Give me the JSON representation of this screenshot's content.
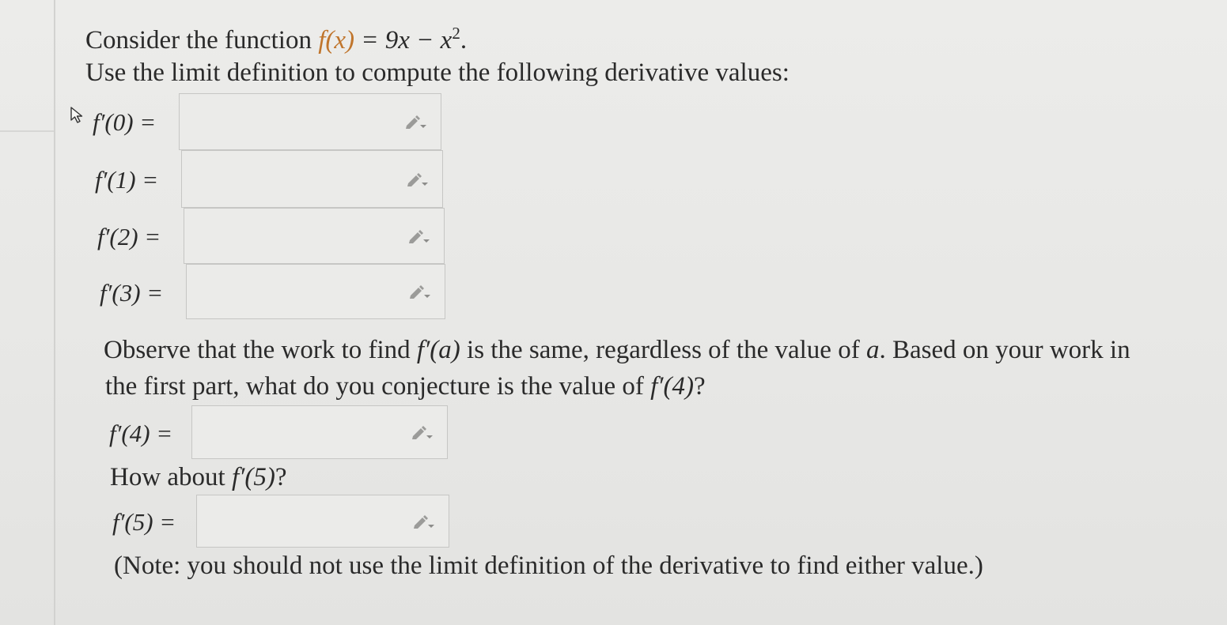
{
  "problem": {
    "intro_prefix": "Consider the function ",
    "function_name": "f(x)",
    "function_rhs": " = 9x − x",
    "exponent": "2",
    "intro_suffix": ".",
    "instruction": "Use the limit definition to compute the following derivative values:"
  },
  "first_part": {
    "rows": [
      {
        "label": "f′(0) =",
        "value": ""
      },
      {
        "label": "f′(1) =",
        "value": ""
      },
      {
        "label": "f′(2) =",
        "value": ""
      },
      {
        "label": "f′(3) =",
        "value": ""
      }
    ]
  },
  "second_part": {
    "observe_prefix": "Observe that the work to find ",
    "observe_fa": "f′(a)",
    "observe_middle": " is the same, regardless of the value of ",
    "observe_a": "a",
    "observe_suffix": ". Based on your work in",
    "conjecture_prefix": "the first part, what do you conjecture is the value of ",
    "conjecture_f4": "f′(4)",
    "conjecture_suffix": "?",
    "f4_label": "f′(4) =",
    "f4_value": "",
    "how_prefix": "How about ",
    "how_f5": "f′(5)",
    "how_suffix": "?",
    "f5_label": "f′(5) =",
    "f5_value": "",
    "note": "(Note: you should not use the limit definition of the derivative to find either value.)"
  },
  "icons": {
    "answer_input_icon": "pencil-dropdown-icon",
    "pointer": "mouse-cursor-icon"
  },
  "colors": {
    "highlight": "#c0752c",
    "text": "#2a2a2a",
    "input_border": "#c6c6c4"
  }
}
